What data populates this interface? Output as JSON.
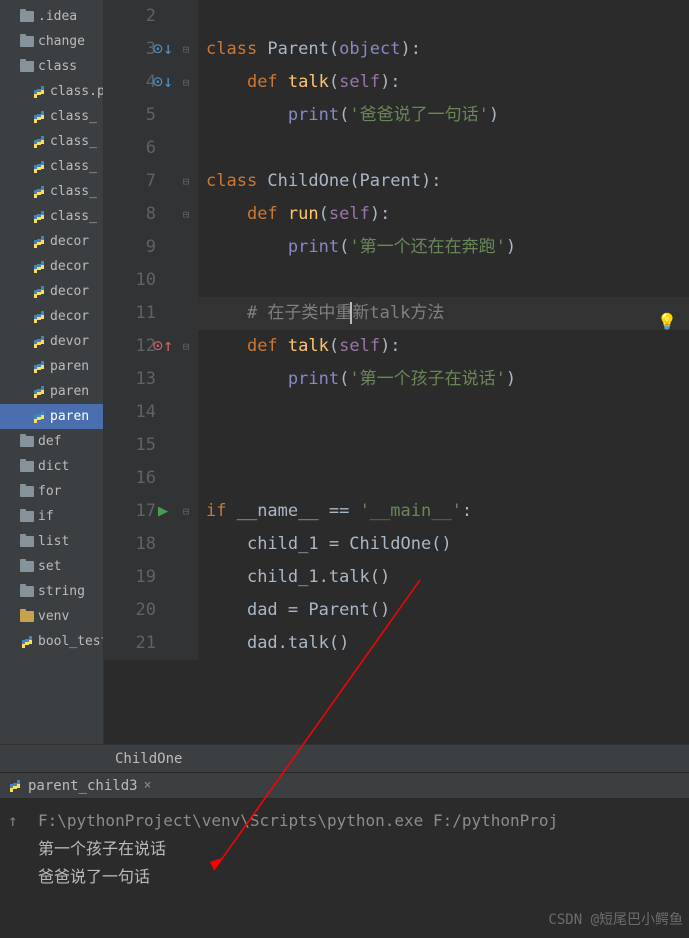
{
  "sidebar": {
    "items": [
      {
        "label": ".idea",
        "type": "folder",
        "indent": 1
      },
      {
        "label": "change",
        "type": "folder",
        "indent": 1
      },
      {
        "label": "class",
        "type": "folder",
        "indent": 1
      },
      {
        "label": "class.p",
        "type": "py",
        "indent": 2
      },
      {
        "label": "class_",
        "type": "py",
        "indent": 2
      },
      {
        "label": "class_",
        "type": "py",
        "indent": 2
      },
      {
        "label": "class_",
        "type": "py",
        "indent": 2
      },
      {
        "label": "class_",
        "type": "py",
        "indent": 2
      },
      {
        "label": "class_",
        "type": "py",
        "indent": 2
      },
      {
        "label": "decor",
        "type": "py",
        "indent": 2
      },
      {
        "label": "decor",
        "type": "py",
        "indent": 2
      },
      {
        "label": "decor",
        "type": "py",
        "indent": 2
      },
      {
        "label": "decor",
        "type": "py",
        "indent": 2
      },
      {
        "label": "devor",
        "type": "py",
        "indent": 2
      },
      {
        "label": "paren",
        "type": "py",
        "indent": 2
      },
      {
        "label": "paren",
        "type": "py",
        "indent": 2
      },
      {
        "label": "paren",
        "type": "py",
        "indent": 2,
        "selected": true
      },
      {
        "label": "def",
        "type": "folder",
        "indent": 1
      },
      {
        "label": "dict",
        "type": "folder",
        "indent": 1
      },
      {
        "label": "for",
        "type": "folder",
        "indent": 1
      },
      {
        "label": "if",
        "type": "folder",
        "indent": 1
      },
      {
        "label": "list",
        "type": "folder",
        "indent": 1
      },
      {
        "label": "set",
        "type": "folder",
        "indent": 1
      },
      {
        "label": "string",
        "type": "folder",
        "indent": 1
      },
      {
        "label": "venv",
        "type": "folder-gold",
        "indent": 1
      },
      {
        "label": "bool_test",
        "type": "py",
        "indent": 1
      }
    ]
  },
  "editor": {
    "lines": [
      "2",
      "3",
      "4",
      "5",
      "6",
      "7",
      "8",
      "9",
      "10",
      "11",
      "12",
      "13",
      "14",
      "15",
      "16",
      "17",
      "18",
      "19",
      "20",
      "21"
    ],
    "breadcrumb": "ChildOne",
    "code": {
      "l3_class": "class ",
      "l3_name": "Parent",
      "l3_paren": "(",
      "l3_obj": "object",
      "l3_end": "):",
      "l4_def": "def ",
      "l4_name": "talk",
      "l4_paren": "(",
      "l4_self": "self",
      "l4_end": "):",
      "l5_print": "print",
      "l5_paren": "(",
      "l5_str": "'爸爸说了一句话'",
      "l5_end": ")",
      "l7_class": "class ",
      "l7_name": "ChildOne",
      "l7_paren": "(Parent):",
      "l8_def": "def ",
      "l8_name": "run",
      "l8_paren": "(",
      "l8_self": "self",
      "l8_end": "):",
      "l9_print": "print",
      "l9_paren": "(",
      "l9_str": "'第一个还在在奔跑'",
      "l9_end": ")",
      "l11_comment": "# 在子类中重新talk方法",
      "l12_def": "def ",
      "l12_name": "talk",
      "l12_paren": "(",
      "l12_self": "self",
      "l12_end": "):",
      "l13_print": "print",
      "l13_paren": "(",
      "l13_str": "'第一个孩子在说话'",
      "l13_end": ")",
      "l17_if": "if ",
      "l17_name": "__name__ ",
      "l17_eq": "== ",
      "l17_main": "'__main__'",
      "l17_end": ":",
      "l18": "child_1 = ChildOne()",
      "l19": "child_1.talk()",
      "l20": "dad = Parent()",
      "l21": "dad.talk()"
    }
  },
  "console": {
    "tab": "parent_child3",
    "cmd": "F:\\pythonProject\\venv\\Scripts\\python.exe F:/pythonProj",
    "out1": "第一个孩子在说话",
    "out2": "爸爸说了一句话",
    "watermark": "CSDN @短尾巴小鳄鱼"
  }
}
